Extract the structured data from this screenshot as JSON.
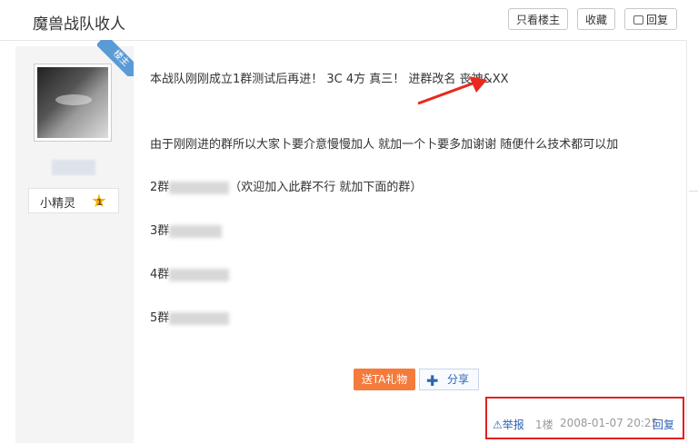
{
  "header": {
    "title": "魔兽战队收人",
    "only_author_label": "只看楼主",
    "favorite_label": "收藏",
    "reply_label": "回复"
  },
  "author": {
    "badge": "楼主",
    "level_name": "小精灵",
    "level_num": "1"
  },
  "post": {
    "line1": "本战队刚刚成立1群测试后再进！ 3C 4方 真三！ 进群改名  丧神&XX",
    "line2": "由于刚刚进的群所以大家卜要介意慢慢加人 就加一个卜要多加谢谢 随便什么技术都可以加",
    "g2": "2群",
    "g2_note": "（欢迎加入此群不行 就加下面的群）",
    "g3": "3群",
    "g4": "4群",
    "g5": "5群"
  },
  "actions": {
    "gift_label": "送TA礼物",
    "share_label": "分享"
  },
  "footer": {
    "report_label": "举报",
    "floor": "1楼",
    "time": "2008-01-07 20:25",
    "reply_label": "回复"
  },
  "colors": {
    "link": "#2d64b3",
    "gift": "#f47b3b",
    "highlight_box": "#e02020",
    "arrow": "#e8291c"
  }
}
